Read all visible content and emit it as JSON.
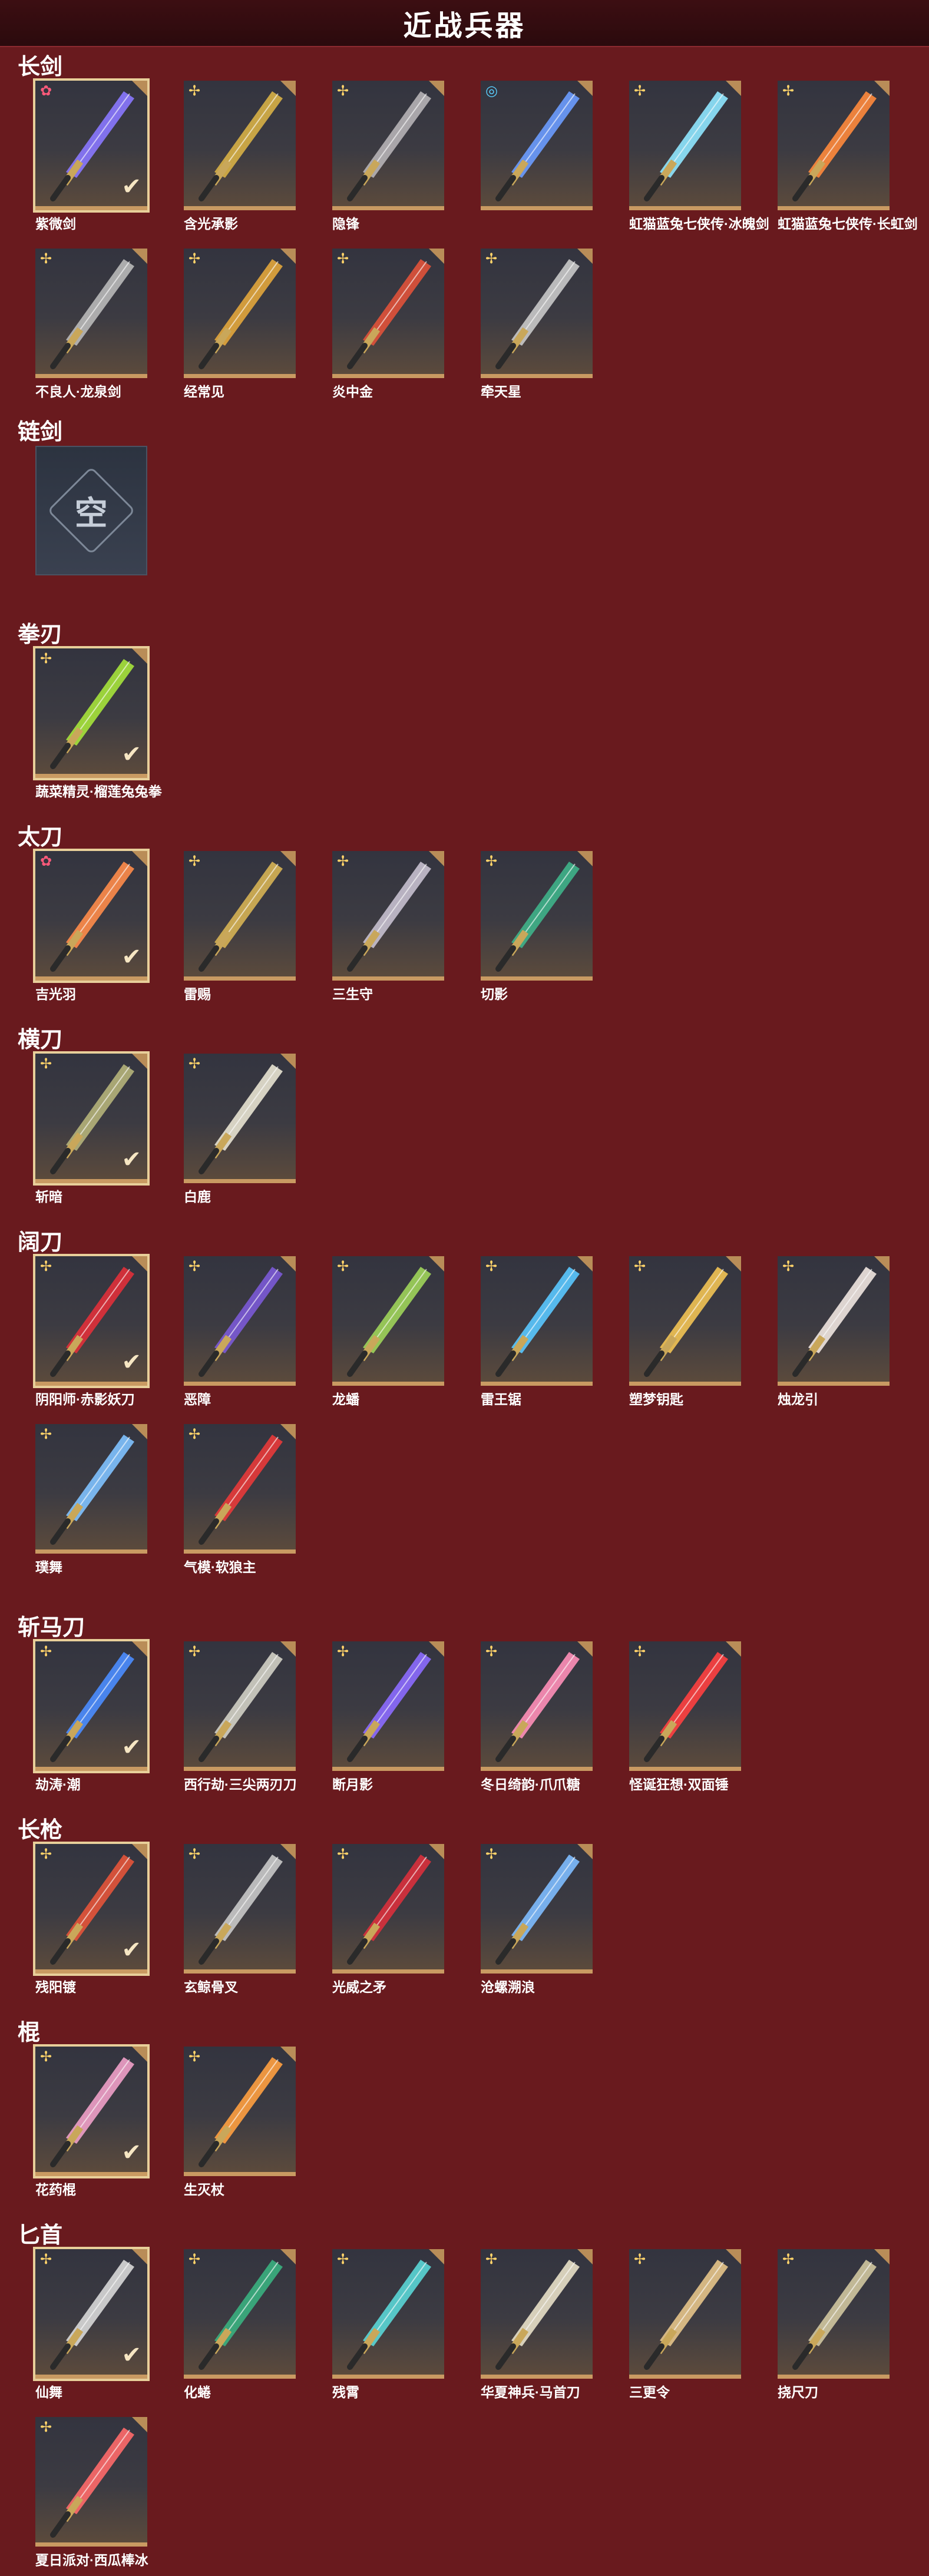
{
  "header": {
    "title": "近战兵器"
  },
  "badge_icons": {
    "star": "✢",
    "flower": "✿"
  },
  "check_icon": "✔",
  "colors": {
    "background": "#691a1e",
    "card_border": "#c99a62",
    "header": "#2b0a0d"
  },
  "sections": [
    {
      "title": "长剑",
      "items": [
        {
          "label": "紫微剑",
          "badge": "flower",
          "selected": true,
          "color": "#8a78ff"
        },
        {
          "label": "含光承影",
          "badge": "star",
          "selected": false,
          "color": "#d7b046"
        },
        {
          "label": "隐锋",
          "badge": "star",
          "selected": false,
          "color": "#b6b3b6"
        },
        {
          "label": "",
          "badge": "rainbow",
          "selected": false,
          "color": "#6c9cff"
        },
        {
          "label": "虹猫蓝兔七侠传·冰魄剑",
          "badge": "star",
          "selected": false,
          "color": "#8fe7ff"
        },
        {
          "label": "虹猫蓝兔七侠传·长虹剑",
          "badge": "star",
          "selected": false,
          "color": "#ff8a3c"
        },
        {
          "label": "不良人·龙泉剑",
          "badge": "star",
          "selected": false,
          "color": "#b9b9b9"
        },
        {
          "label": "经常见",
          "badge": "star",
          "selected": false,
          "color": "#e2a63c"
        },
        {
          "label": "炎中金",
          "badge": "star",
          "selected": false,
          "color": "#e0523a"
        },
        {
          "label": "牵天星",
          "badge": "star",
          "selected": false,
          "color": "#c9c9c9"
        }
      ]
    },
    {
      "title": "链剑",
      "empty": true,
      "empty_text": "空"
    },
    {
      "title": "拳刃",
      "items": [
        {
          "label": "蔬菜精灵·榴莲兔兔拳",
          "badge": "star",
          "selected": true,
          "color": "#a6e33b"
        }
      ]
    },
    {
      "title": "太刀",
      "items": [
        {
          "label": "吉光羽",
          "badge": "flower",
          "selected": true,
          "color": "#ff8c4a"
        },
        {
          "label": "雷赐",
          "badge": "star",
          "selected": false,
          "color": "#d6b254"
        },
        {
          "label": "三生守",
          "badge": "star",
          "selected": false,
          "color": "#c7c0cf"
        },
        {
          "label": "切影",
          "badge": "star",
          "selected": false,
          "color": "#3fb38a"
        }
      ]
    },
    {
      "title": "横刀",
      "items": [
        {
          "label": "斩暗",
          "badge": "star",
          "selected": true,
          "color": "#b5b27a"
        },
        {
          "label": "白鹿",
          "badge": "star",
          "selected": false,
          "color": "#e8e3d2"
        }
      ]
    },
    {
      "title": "阔刀",
      "items": [
        {
          "label": "阴阳师·赤影妖刀",
          "badge": "star",
          "selected": true,
          "color": "#e0303a"
        },
        {
          "label": "恶障",
          "badge": "star",
          "selected": false,
          "color": "#7b5ad6"
        },
        {
          "label": "龙蟠",
          "badge": "star",
          "selected": false,
          "color": "#9fd45a"
        },
        {
          "label": "雷王锯",
          "badge": "star",
          "selected": false,
          "color": "#5ac8ff"
        },
        {
          "label": "塑梦钥匙",
          "badge": "star",
          "selected": false,
          "color": "#f2c354"
        },
        {
          "label": "烛龙引",
          "badge": "star",
          "selected": false,
          "color": "#efe6e0"
        },
        {
          "label": "璞舞",
          "badge": "star",
          "selected": false,
          "color": "#7fc2ff"
        },
        {
          "label": "气模·软狼主",
          "badge": "star",
          "selected": false,
          "color": "#e83a3a"
        }
      ]
    },
    {
      "title": "斩马刀",
      "items": [
        {
          "label": "劫涛·潮",
          "badge": "star",
          "selected": true,
          "color": "#4b8dff"
        },
        {
          "label": "西行劫·三尖两刃刀",
          "badge": "star",
          "selected": false,
          "color": "#d2d0c5"
        },
        {
          "label": "断月影",
          "badge": "star",
          "selected": false,
          "color": "#8c6cff"
        },
        {
          "label": "冬日绮韵·爪爪糖",
          "badge": "star",
          "selected": false,
          "color": "#ff8fb8"
        },
        {
          "label": "怪诞狂想·双面锤",
          "badge": "star",
          "selected": false,
          "color": "#ff4040"
        }
      ]
    },
    {
      "title": "长枪",
      "items": [
        {
          "label": "残阳镀",
          "badge": "star",
          "selected": true,
          "color": "#e4543a"
        },
        {
          "label": "玄鲸骨叉",
          "badge": "star",
          "selected": false,
          "color": "#c9c9c9"
        },
        {
          "label": "光威之矛",
          "badge": "star",
          "selected": false,
          "color": "#d9303c"
        },
        {
          "label": "沧螺溯浪",
          "badge": "star",
          "selected": false,
          "color": "#7ebcff"
        }
      ]
    },
    {
      "title": "棍",
      "items": [
        {
          "label": "花药棍",
          "badge": "star",
          "selected": true,
          "color": "#f0a0c8"
        },
        {
          "label": "生灭杖",
          "badge": "star",
          "selected": false,
          "color": "#ffa040"
        }
      ]
    },
    {
      "title": "匕首",
      "items": [
        {
          "label": "仙舞",
          "badge": "star",
          "selected": true,
          "color": "#d8d8d8"
        },
        {
          "label": "化蜷",
          "badge": "star",
          "selected": false,
          "color": "#3ab080"
        },
        {
          "label": "残霄",
          "badge": "star",
          "selected": false,
          "color": "#5ad6d6"
        },
        {
          "label": "华夏神兵·马首刀",
          "badge": "star",
          "selected": false,
          "color": "#e8e0c8"
        },
        {
          "label": "三更令",
          "badge": "star",
          "selected": false,
          "color": "#e6c48a"
        },
        {
          "label": "挠尺刀",
          "badge": "star",
          "selected": false,
          "color": "#d0c6a0"
        },
        {
          "label": "夏日派对·西瓜棒冰",
          "badge": "star",
          "selected": false,
          "color": "#ff6a6a"
        }
      ]
    }
  ]
}
